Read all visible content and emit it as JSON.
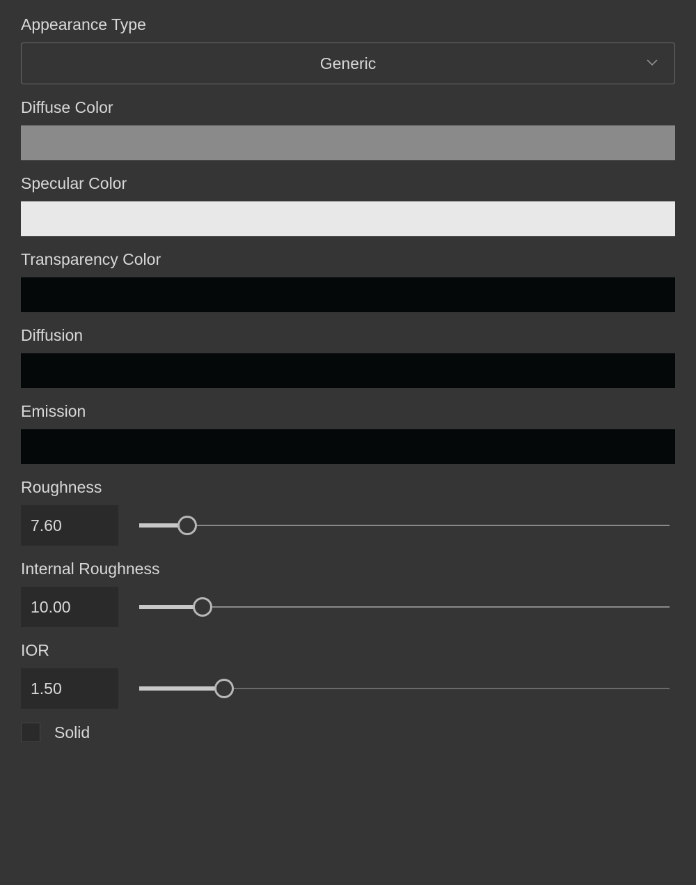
{
  "appearance_type": {
    "label": "Appearance Type",
    "value": "Generic"
  },
  "diffuse_color": {
    "label": "Diffuse Color",
    "value": "#8a8a8a"
  },
  "specular_color": {
    "label": "Specular Color",
    "value": "#e8e8e8"
  },
  "transparency_color": {
    "label": "Transparency Color",
    "value": "#050808"
  },
  "diffusion": {
    "label": "Diffusion",
    "value": "#050808"
  },
  "emission": {
    "label": "Emission",
    "value": "#050808"
  },
  "roughness": {
    "label": "Roughness",
    "value": "7.60",
    "slider_percent": 9
  },
  "internal_roughness": {
    "label": "Internal Roughness",
    "value": "10.00",
    "slider_percent": 12
  },
  "ior": {
    "label": "IOR",
    "value": "1.50",
    "slider_percent": 16
  },
  "solid": {
    "label": "Solid",
    "checked": false
  }
}
